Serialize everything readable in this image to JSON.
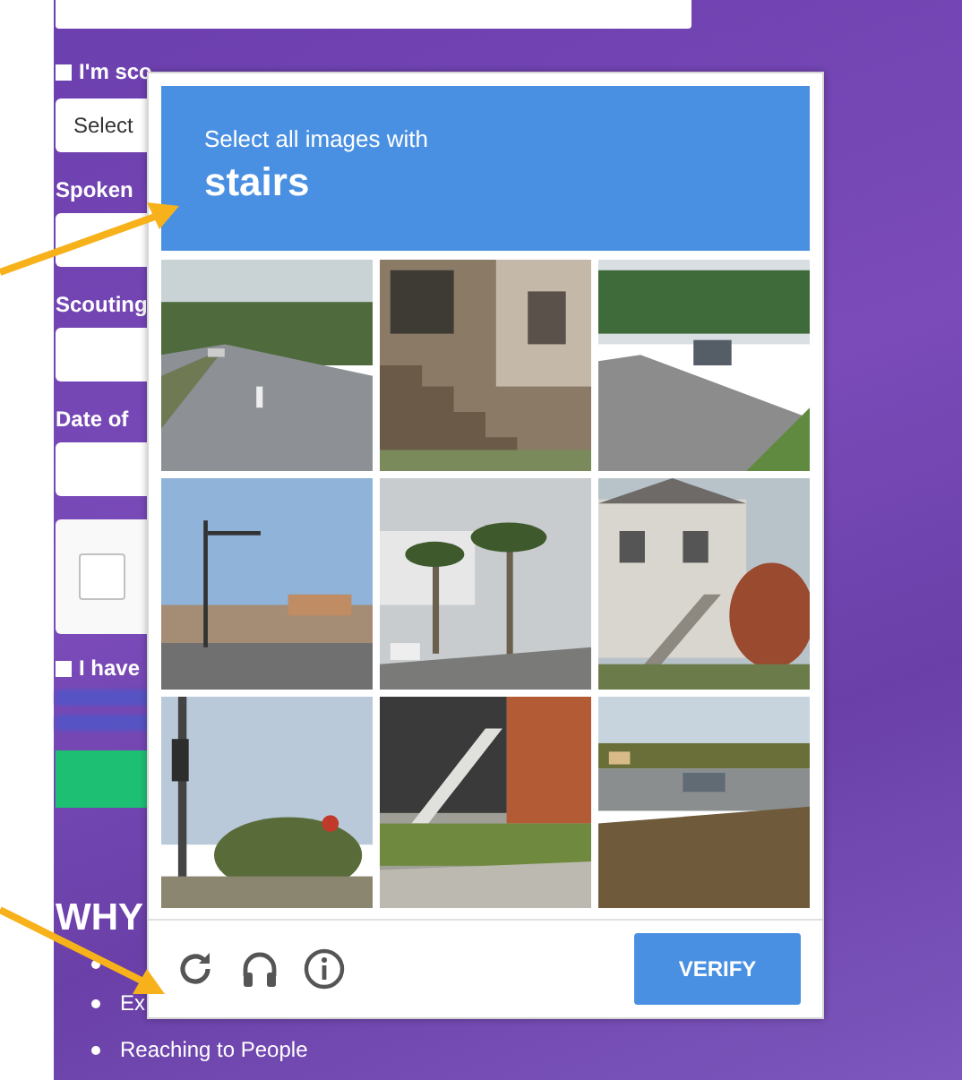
{
  "form": {
    "scout_checkbox": {
      "label": "I'm sco",
      "checked": false
    },
    "select": {
      "value": "Select"
    },
    "fields": [
      {
        "label": "Spoken"
      },
      {
        "label": "Scouting"
      },
      {
        "label": "Date of"
      }
    ],
    "robot_checkbox": {
      "checked": false
    },
    "terms_checkbox": {
      "label": "I have",
      "checked": false
    },
    "heading": "WHY",
    "bullets": [
      {
        "kind": "covered"
      },
      {
        "kind": "text",
        "text": "Ex"
      },
      {
        "kind": "text",
        "text": "Reaching to People"
      }
    ]
  },
  "captcha": {
    "instruction": "Select all images with",
    "target": "stairs",
    "verify_button": "VERIFY"
  }
}
